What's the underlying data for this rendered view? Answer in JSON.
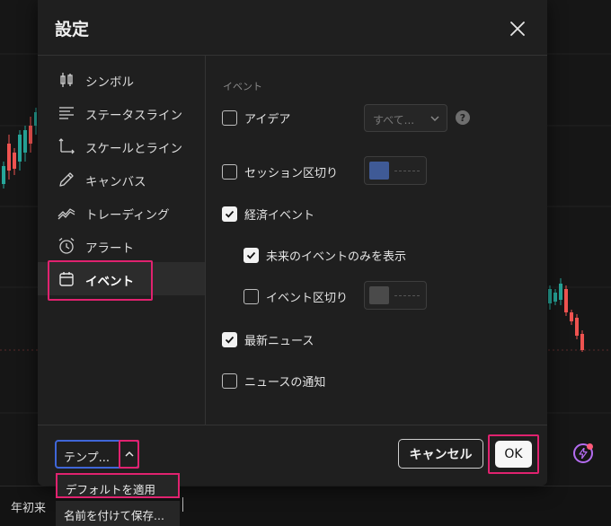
{
  "dialog": {
    "title": "設定",
    "sidebar": [
      {
        "label": "シンボル",
        "icon": "candlestick-icon"
      },
      {
        "label": "ステータスライン",
        "icon": "status-line-icon"
      },
      {
        "label": "スケールとライン",
        "icon": "scale-lines-icon"
      },
      {
        "label": "キャンバス",
        "icon": "pencil-icon"
      },
      {
        "label": "トレーディング",
        "icon": "trading-icon"
      },
      {
        "label": "アラート",
        "icon": "alarm-clock-icon"
      },
      {
        "label": "イベント",
        "icon": "calendar-icon",
        "active": true
      }
    ],
    "content": {
      "section_label": "イベント",
      "ideas": {
        "label": "アイデア",
        "checked": false,
        "select_value": "すべて..."
      },
      "session_breaks": {
        "label": "セッション区切り",
        "checked": false,
        "color": "#3f5a96"
      },
      "economic_events": {
        "label": "経済イベント",
        "checked": true
      },
      "future_only": {
        "label": "未来のイベントのみを表示",
        "checked": true
      },
      "event_breaks": {
        "label": "イベント区切り",
        "checked": false,
        "color": "#4a4a4a"
      },
      "latest_news": {
        "label": "最新ニュース",
        "checked": true
      },
      "news_notification": {
        "label": "ニュースの通知",
        "checked": false
      }
    },
    "footer": {
      "template_label": "テンプ...",
      "cancel_label": "キャンセル",
      "ok_label": "OK"
    }
  },
  "template_menu": {
    "items": [
      "デフォルトを適用",
      "名前を付けて保存..."
    ]
  },
  "bottom_bar": {
    "range_label": "年初来"
  },
  "colors": {
    "accent_highlight": "#e0226f",
    "template_border": "#3f66d8",
    "bolt": "#b46cf0"
  }
}
